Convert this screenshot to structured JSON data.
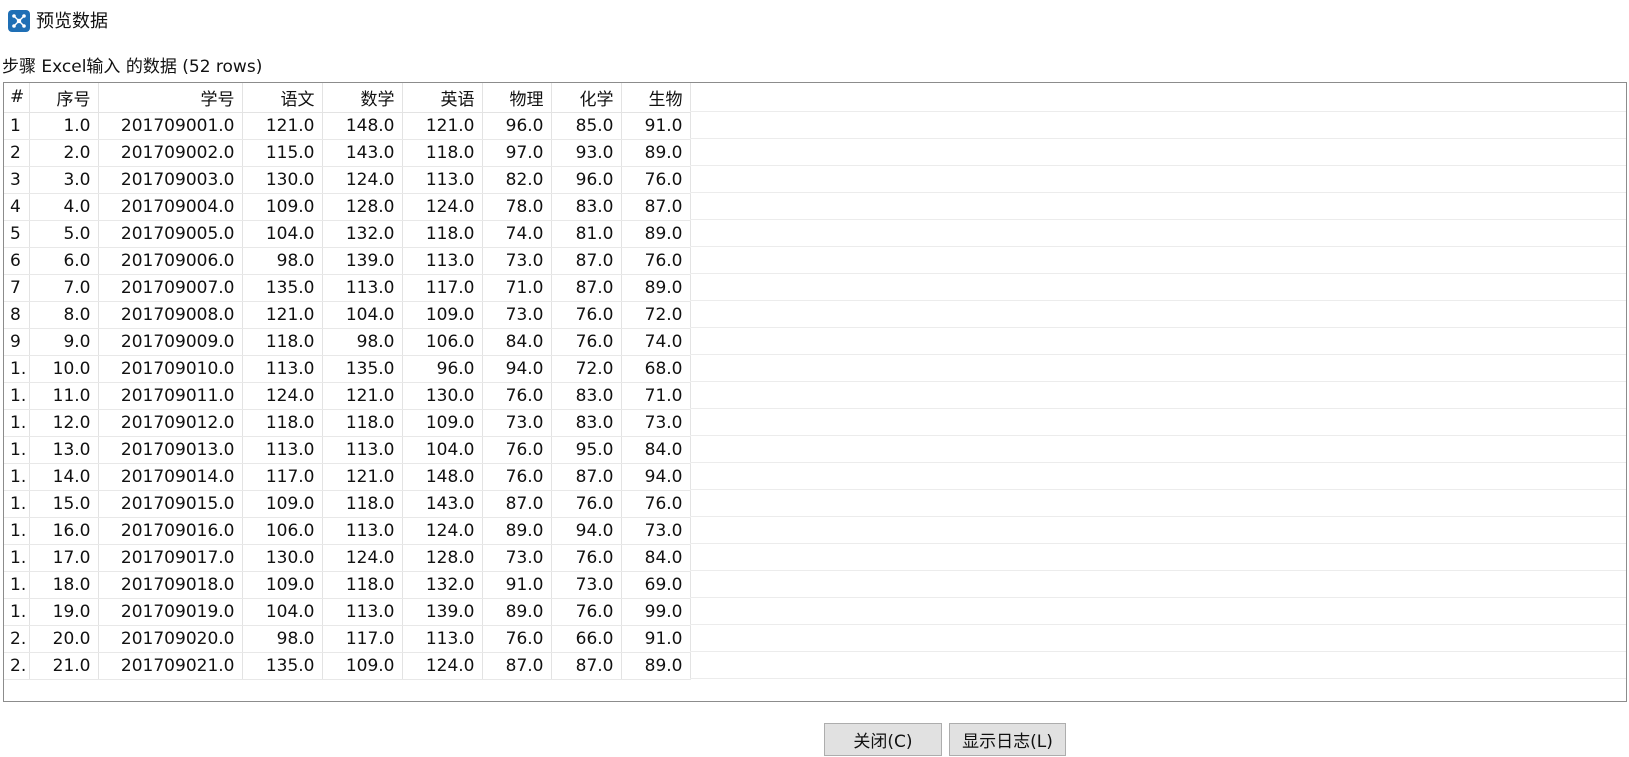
{
  "window": {
    "title": "预览数据",
    "icon": "kettle-spoon-icon",
    "accent_color": "#1f6fb5"
  },
  "caption": "步骤 Excel输入 的数据  (52 rows)",
  "table": {
    "columns": [
      "#",
      "序号",
      "学号",
      "语文",
      "数学",
      "英语",
      "物理",
      "化学",
      "生物"
    ],
    "rows": [
      [
        "1",
        "1.0",
        "201709001.0",
        "121.0",
        "148.0",
        "121.0",
        "96.0",
        "85.0",
        "91.0"
      ],
      [
        "2",
        "2.0",
        "201709002.0",
        "115.0",
        "143.0",
        "118.0",
        "97.0",
        "93.0",
        "89.0"
      ],
      [
        "3",
        "3.0",
        "201709003.0",
        "130.0",
        "124.0",
        "113.0",
        "82.0",
        "96.0",
        "76.0"
      ],
      [
        "4",
        "4.0",
        "201709004.0",
        "109.0",
        "128.0",
        "124.0",
        "78.0",
        "83.0",
        "87.0"
      ],
      [
        "5",
        "5.0",
        "201709005.0",
        "104.0",
        "132.0",
        "118.0",
        "74.0",
        "81.0",
        "89.0"
      ],
      [
        "6",
        "6.0",
        "201709006.0",
        "98.0",
        "139.0",
        "113.0",
        "73.0",
        "87.0",
        "76.0"
      ],
      [
        "7",
        "7.0",
        "201709007.0",
        "135.0",
        "113.0",
        "117.0",
        "71.0",
        "87.0",
        "89.0"
      ],
      [
        "8",
        "8.0",
        "201709008.0",
        "121.0",
        "104.0",
        "109.0",
        "73.0",
        "76.0",
        "72.0"
      ],
      [
        "9",
        "9.0",
        "201709009.0",
        "118.0",
        "98.0",
        "106.0",
        "84.0",
        "76.0",
        "74.0"
      ],
      [
        "1.",
        "10.0",
        "201709010.0",
        "113.0",
        "135.0",
        "96.0",
        "94.0",
        "72.0",
        "68.0"
      ],
      [
        "1.",
        "11.0",
        "201709011.0",
        "124.0",
        "121.0",
        "130.0",
        "76.0",
        "83.0",
        "71.0"
      ],
      [
        "1.",
        "12.0",
        "201709012.0",
        "118.0",
        "118.0",
        "109.0",
        "73.0",
        "83.0",
        "73.0"
      ],
      [
        "1.",
        "13.0",
        "201709013.0",
        "113.0",
        "113.0",
        "104.0",
        "76.0",
        "95.0",
        "84.0"
      ],
      [
        "1.",
        "14.0",
        "201709014.0",
        "117.0",
        "121.0",
        "148.0",
        "76.0",
        "87.0",
        "94.0"
      ],
      [
        "1.",
        "15.0",
        "201709015.0",
        "109.0",
        "118.0",
        "143.0",
        "87.0",
        "76.0",
        "76.0"
      ],
      [
        "1.",
        "16.0",
        "201709016.0",
        "106.0",
        "113.0",
        "124.0",
        "89.0",
        "94.0",
        "73.0"
      ],
      [
        "1.",
        "17.0",
        "201709017.0",
        "130.0",
        "124.0",
        "128.0",
        "73.0",
        "76.0",
        "84.0"
      ],
      [
        "1.",
        "18.0",
        "201709018.0",
        "109.0",
        "118.0",
        "132.0",
        "91.0",
        "73.0",
        "69.0"
      ],
      [
        "1.",
        "19.0",
        "201709019.0",
        "104.0",
        "113.0",
        "139.0",
        "89.0",
        "76.0",
        "99.0"
      ],
      [
        "2.",
        "20.0",
        "201709020.0",
        "98.0",
        "117.0",
        "113.0",
        "76.0",
        "66.0",
        "91.0"
      ],
      [
        "2.",
        "21.0",
        "201709021.0",
        "135.0",
        "109.0",
        "124.0",
        "87.0",
        "87.0",
        "89.0"
      ]
    ]
  },
  "buttons": {
    "close_label": "关闭(C)",
    "show_log_label": "显示日志(L)"
  }
}
